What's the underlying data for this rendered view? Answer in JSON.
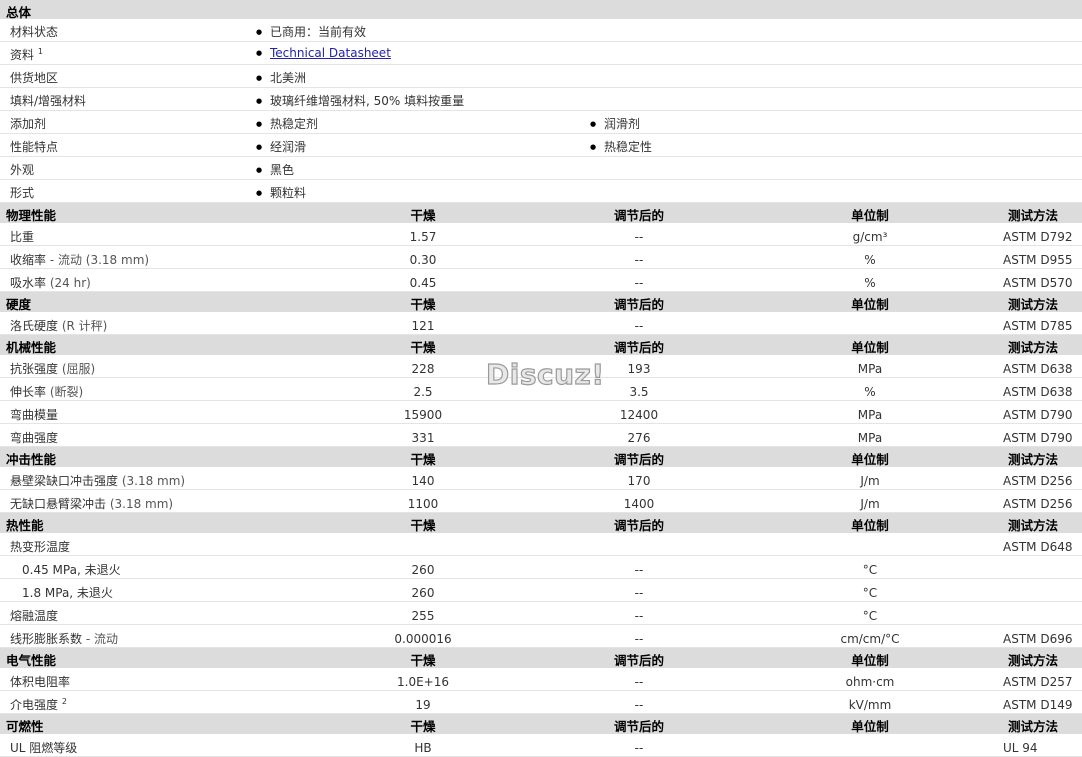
{
  "general": {
    "title": "总体",
    "rows": [
      {
        "label": "材料状态",
        "values": [
          "已商用：当前有效"
        ]
      },
      {
        "label": "资料",
        "sup": "1",
        "values": [
          "Technical Datasheet"
        ],
        "link": true
      },
      {
        "label": "供货地区",
        "values": [
          "北美洲"
        ]
      },
      {
        "label": "填料/增强材料",
        "values": [
          "玻璃纤维增强材料, 50% 填料按重量"
        ]
      },
      {
        "label": "添加剂",
        "values": [
          "热稳定剂",
          "润滑剂"
        ]
      },
      {
        "label": "性能特点",
        "values": [
          "经润滑",
          "热稳定性"
        ]
      },
      {
        "label": "外观",
        "values": [
          "黑色"
        ]
      },
      {
        "label": "形式",
        "values": [
          "颗粒料"
        ]
      }
    ]
  },
  "columns": {
    "dry": "干燥",
    "conditioned": "调节后的",
    "unit": "单位制",
    "method": "测试方法"
  },
  "sections": [
    {
      "title": "物理性能",
      "rows": [
        {
          "label": "比重",
          "note": "",
          "dry": "1.57",
          "cond": "--",
          "unit": "g/cm³",
          "method": "ASTM D792"
        },
        {
          "label": "收缩率",
          "note": " - 流动 (3.18 mm)",
          "dry": "0.30",
          "cond": "--",
          "unit": "%",
          "method": "ASTM D955"
        },
        {
          "label": "吸水率",
          "note": " (24 hr)",
          "dry": "0.45",
          "cond": "--",
          "unit": "%",
          "method": "ASTM D570"
        }
      ]
    },
    {
      "title": "硬度",
      "rows": [
        {
          "label": "洛氏硬度",
          "note": " (R 计秤)",
          "dry": "121",
          "cond": "--",
          "unit": "",
          "method": "ASTM D785"
        }
      ]
    },
    {
      "title": "机械性能",
      "rows": [
        {
          "label": "抗张强度",
          "note": " (屈服)",
          "dry": "228",
          "cond": "193",
          "unit": "MPa",
          "method": "ASTM D638"
        },
        {
          "label": "伸长率",
          "note": " (断裂)",
          "dry": "2.5",
          "cond": "3.5",
          "unit": "%",
          "method": "ASTM D638"
        },
        {
          "label": "弯曲模量",
          "note": "",
          "dry": "15900",
          "cond": "12400",
          "unit": "MPa",
          "method": "ASTM D790"
        },
        {
          "label": "弯曲强度",
          "note": "",
          "dry": "331",
          "cond": "276",
          "unit": "MPa",
          "method": "ASTM D790"
        }
      ]
    },
    {
      "title": "冲击性能",
      "rows": [
        {
          "label": "悬壁梁缺口冲击强度",
          "note": " (3.18 mm)",
          "dry": "140",
          "cond": "170",
          "unit": "J/m",
          "method": "ASTM D256"
        },
        {
          "label": "无缺口悬臂梁冲击",
          "note": " (3.18 mm)",
          "dry": "1100",
          "cond": "1400",
          "unit": "J/m",
          "method": "ASTM D256"
        }
      ]
    },
    {
      "title": "热性能",
      "rows": [
        {
          "label": "热变形温度",
          "note": "",
          "dry": "",
          "cond": "",
          "unit": "",
          "method": "ASTM D648"
        },
        {
          "label": "0.45 MPa, 未退火",
          "note": "",
          "indent": true,
          "dry": "260",
          "cond": "--",
          "unit": "°C",
          "method": ""
        },
        {
          "label": "1.8 MPa, 未退火",
          "note": "",
          "indent": true,
          "dry": "260",
          "cond": "--",
          "unit": "°C",
          "method": ""
        },
        {
          "label": "熔融温度",
          "note": "",
          "dry": "255",
          "cond": "--",
          "unit": "°C",
          "method": ""
        },
        {
          "label": "线形膨胀系数",
          "note": " - 流动",
          "dry": "0.000016",
          "cond": "--",
          "unit": "cm/cm/°C",
          "method": "ASTM D696"
        }
      ]
    },
    {
      "title": "电气性能",
      "rows": [
        {
          "label": "体积电阻率",
          "note": "",
          "dry": "1.0E+16",
          "cond": "--",
          "unit": "ohm·cm",
          "method": "ASTM D257"
        },
        {
          "label": "介电强度",
          "sup": "2",
          "note": "",
          "dry": "19",
          "cond": "--",
          "unit": "kV/mm",
          "method": "ASTM D149"
        }
      ]
    },
    {
      "title": "可燃性",
      "rows": [
        {
          "label": "UL 阻燃等级",
          "note": "",
          "dry": "HB",
          "cond": "--",
          "unit": "",
          "method": "UL 94"
        }
      ]
    }
  ],
  "watermark": "Discuz!"
}
